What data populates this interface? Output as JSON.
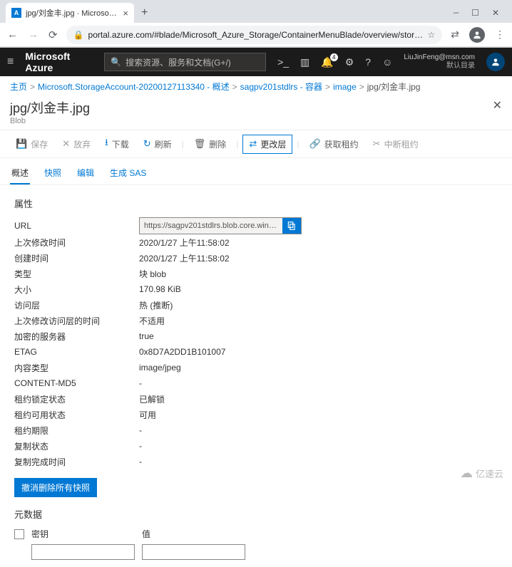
{
  "browser": {
    "tab_title": "jpg/刘金丰.jpg · Microsoft Azu…",
    "url_display": "portal.azure.com/#blade/Microsoft_Azure_Storage/ContainerMenuBlade/overview/storageAccountId…"
  },
  "azure_header": {
    "brand": "Microsoft Azure",
    "search_placeholder": "搜索资源、服务和文档(G+/)",
    "notification_count": "4",
    "user_email": "LiuJinFeng@msn.com",
    "user_tenant": "默认目录"
  },
  "breadcrumb": {
    "items": [
      "主页",
      "Microsoft.StorageAccount-20200127113340 - 概述",
      "sagpv201stdlrs - 容器",
      "image"
    ],
    "current": "jpg/刘金丰.jpg"
  },
  "blade": {
    "title": "jpg/刘金丰.jpg",
    "subtitle": "Blob"
  },
  "toolbar": {
    "save": "保存",
    "discard": "放弃",
    "download": "下载",
    "refresh": "刷新",
    "delete": "删除",
    "changeTier": "更改层",
    "acquireLease": "获取租约",
    "breakLease": "中断租约"
  },
  "tabs": {
    "overview": "概述",
    "snapshots": "快照",
    "edit": "编辑",
    "generateSas": "生成 SAS"
  },
  "sections": {
    "properties": "属性",
    "metadata": "元数据"
  },
  "props": {
    "url_label": "URL",
    "url_value": "https://sagpv201stdlrs.blob.core.win…",
    "lastModified_label": "上次修改时间",
    "lastModified_value": "2020/1/27 上午11:58:02",
    "created_label": "创建时间",
    "created_value": "2020/1/27 上午11:58:02",
    "type_label": "类型",
    "type_value": "块 blob",
    "size_label": "大小",
    "size_value": "170.98 KiB",
    "accessTier_label": "访问层",
    "accessTier_value": "热 (推断)",
    "accessTierModified_label": "上次修改访问层的时间",
    "accessTierModified_value": "不适用",
    "encrypted_label": "加密的服务器",
    "encrypted_value": "true",
    "etag_label": "ETAG",
    "etag_value": "0x8D7A2DD1B101007",
    "contentType_label": "内容类型",
    "contentType_value": "image/jpeg",
    "contentMd5_label": "CONTENT-MD5",
    "contentMd5_value": "-",
    "leaseStatus_label": "租约锁定状态",
    "leaseStatus_value": "已解锁",
    "leaseState_label": "租约可用状态",
    "leaseState_value": "可用",
    "leaseDuration_label": "租约期限",
    "leaseDuration_value": "-",
    "copyStatus_label": "复制状态",
    "copyStatus_value": "-",
    "copyCompleted_label": "复制完成时间",
    "copyCompleted_value": "-"
  },
  "actions": {
    "undeleteSnapshots": "撤消删除所有快照"
  },
  "metadata_cols": {
    "key": "密钥",
    "value": "值"
  },
  "watermark": "亿速云"
}
